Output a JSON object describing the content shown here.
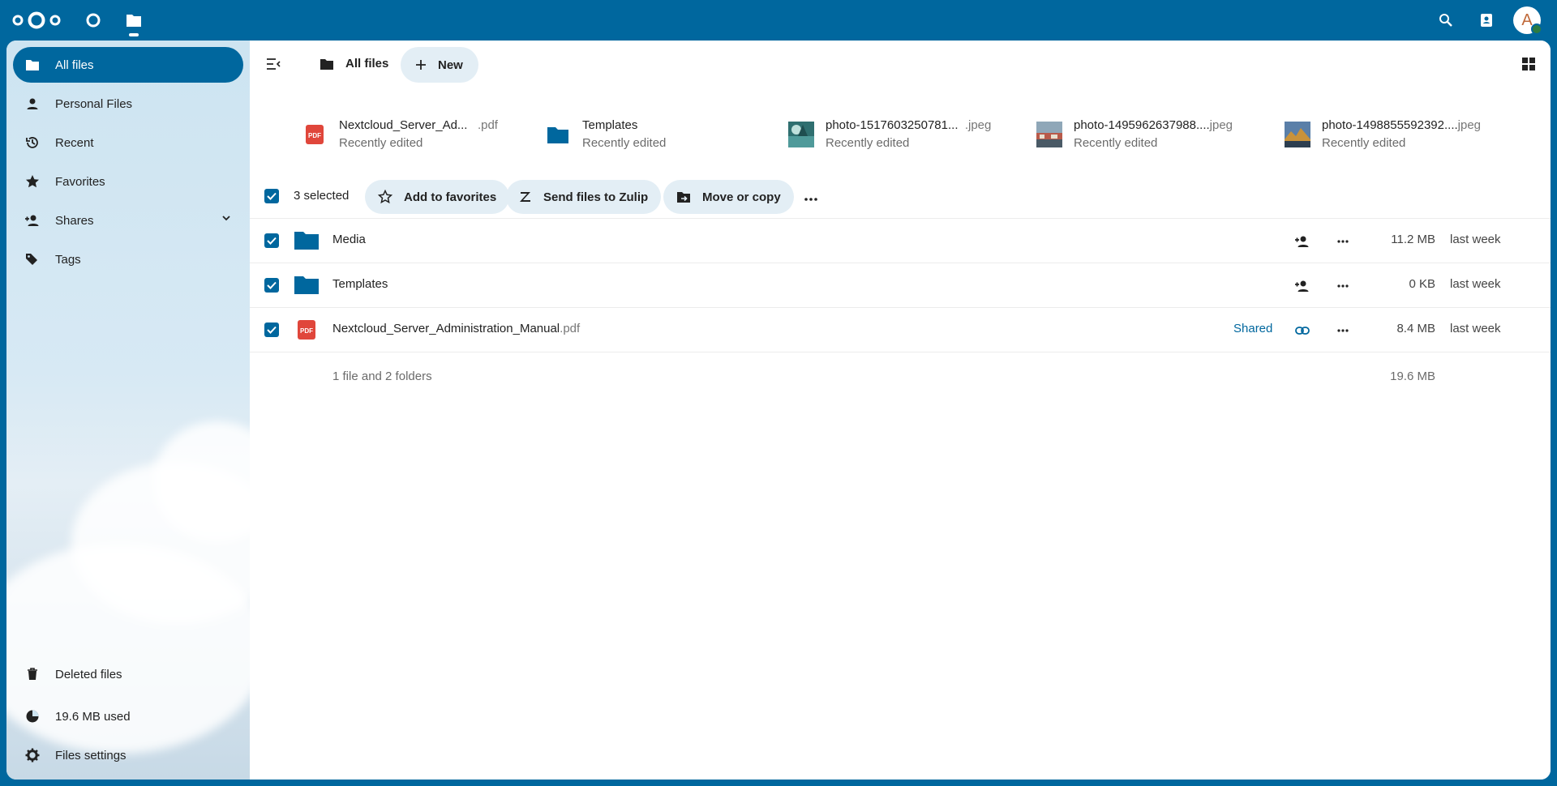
{
  "header": {
    "app_icons": [
      "nextcloud-logo",
      "dashboard-icon",
      "files-icon"
    ],
    "right_icons": [
      "search-icon",
      "contacts-icon"
    ],
    "avatar_letter": "A"
  },
  "sidebar": {
    "items": [
      {
        "label": "All files",
        "icon": "folder-icon",
        "active": true
      },
      {
        "label": "Personal Files",
        "icon": "person-icon"
      },
      {
        "label": "Recent",
        "icon": "history-icon"
      },
      {
        "label": "Favorites",
        "icon": "star-icon"
      },
      {
        "label": "Shares",
        "icon": "share-icon"
      },
      {
        "label": "Tags",
        "icon": "tag-icon"
      }
    ],
    "bottom": {
      "deleted": "Deleted files",
      "quota": "19.6 MB used",
      "settings": "Files settings"
    }
  },
  "toolbar": {
    "breadcrumb": "All files",
    "new_label": "New"
  },
  "recent": [
    {
      "name": "Nextcloud_Server_Ad...",
      "ext": ".pdf",
      "sub": "Recently edited",
      "type": "pdf"
    },
    {
      "name": "Templates",
      "ext": "",
      "sub": "Recently edited",
      "type": "folder"
    },
    {
      "name": "photo-1517603250781...",
      "ext": ".jpeg",
      "sub": "Recently edited",
      "type": "photo1"
    },
    {
      "name": "photo-1495962637988....",
      "ext": "jpeg",
      "sub": "Recently edited",
      "type": "photo2"
    },
    {
      "name": "photo-1498855592392....",
      "ext": "jpeg",
      "sub": "Recently edited",
      "type": "photo3"
    }
  ],
  "selection": {
    "count_label": "3 selected",
    "actions": [
      "Add to favorites",
      "Send files to Zulip",
      "Move or copy"
    ]
  },
  "files": [
    {
      "name": "Media",
      "ext": "",
      "size": "11.2 MB",
      "date": "last week",
      "type": "folder"
    },
    {
      "name": "Templates",
      "ext": "",
      "size": "0 KB",
      "date": "last week",
      "type": "folder"
    },
    {
      "name": "Nextcloud_Server_Administration_Manual",
      "ext": ".pdf",
      "size": "8.4 MB",
      "date": "last week",
      "type": "pdf",
      "shared_label": "Shared"
    }
  ],
  "summary": {
    "count": "1 file and 2 folders",
    "total": "19.6 MB"
  },
  "colors": {
    "primary": "#00679e",
    "pdf": "#e0463b"
  }
}
